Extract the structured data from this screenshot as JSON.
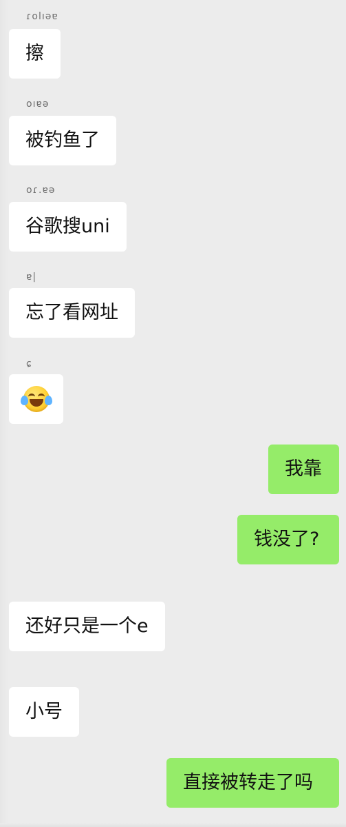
{
  "chat": {
    "messages": [
      {
        "side": "in",
        "sender": "ɾolıəɐ",
        "text": "擦"
      },
      {
        "side": "in",
        "sender": "oıɐə",
        "text": "被钓鱼了"
      },
      {
        "side": "in",
        "sender": "oɾ.ɐə",
        "text": "谷歌搜uni"
      },
      {
        "side": "in",
        "sender": "ɐ|",
        "text": "忘了看网址"
      },
      {
        "side": "in",
        "sender": "ɕ",
        "text": "",
        "emoji": "face-with-tears-of-joy"
      },
      {
        "side": "out",
        "text": "我靠"
      },
      {
        "side": "out",
        "text": "钱没了?"
      },
      {
        "side": "in",
        "text": "还好只是一个e"
      },
      {
        "side": "in",
        "text": "小号"
      },
      {
        "side": "out",
        "text": "直接被转走了吗"
      }
    ]
  },
  "colors": {
    "background": "#ececec",
    "incoming_bubble": "#ffffff",
    "outgoing_bubble": "#95ec69",
    "text": "#111111",
    "sender_name": "#6f6f6f"
  }
}
